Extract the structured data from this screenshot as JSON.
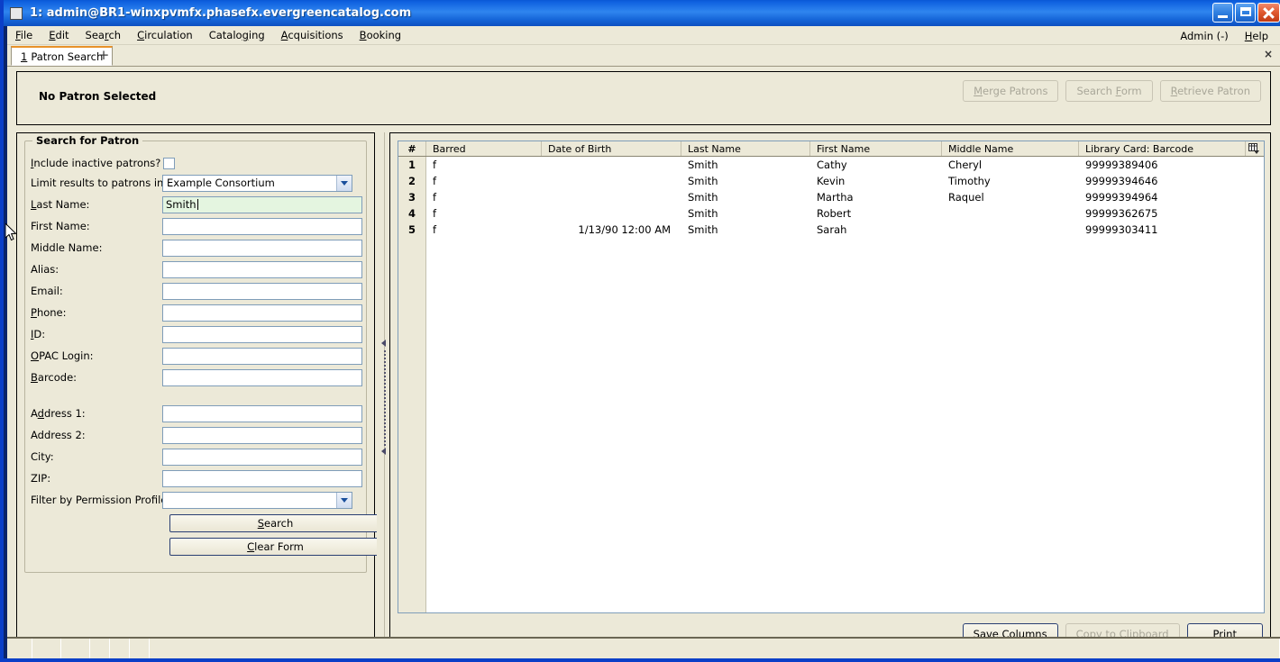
{
  "window": {
    "title": "1: admin@BR1-winxpvmfx.phasefx.evergreencatalog.com",
    "icon": "window-icon",
    "minimize": "minimize-icon",
    "maximize": "maximize-icon",
    "close": "close-icon"
  },
  "menubar": {
    "items": [
      {
        "label": "File",
        "accel": "F"
      },
      {
        "label": "Edit",
        "accel": "E"
      },
      {
        "label": "Search",
        "accel": "r"
      },
      {
        "label": "Circulation",
        "accel": "C"
      },
      {
        "label": "Cataloging",
        "accel": "g"
      },
      {
        "label": "Acquisitions",
        "accel": "A"
      },
      {
        "label": "Booking",
        "accel": "B"
      }
    ],
    "right": [
      {
        "label": "Admin (-)"
      },
      {
        "label": "Help",
        "accel": "H"
      }
    ]
  },
  "tabbar": {
    "tabs": [
      {
        "index": "1",
        "label": "Patron Search",
        "active": true
      }
    ],
    "add_label": "+",
    "close_label": "×"
  },
  "patron_header": {
    "status": "No Patron Selected",
    "buttons": [
      {
        "label": "Merge Patrons",
        "enabled": false
      },
      {
        "label": "Search Form",
        "enabled": false
      },
      {
        "label": "Retrieve Patron",
        "enabled": false
      }
    ]
  },
  "search_form": {
    "legend": "Search for Patron",
    "include_inactive": {
      "label": "Include inactive patrons?",
      "checked": false
    },
    "limit_results": {
      "label": "Limit results to patrons in",
      "value": "Example Consortium"
    },
    "fields": [
      {
        "label": "Last Name:",
        "value": "Smith",
        "focused": true
      },
      {
        "label": "First Name:",
        "value": "",
        "focused": false
      },
      {
        "label": "Middle Name:",
        "value": "",
        "focused": false
      },
      {
        "label": "Alias:",
        "value": "",
        "focused": false
      },
      {
        "label": "Email:",
        "value": "",
        "focused": false
      },
      {
        "label": "Phone:",
        "value": "",
        "focused": false
      },
      {
        "label": "ID:",
        "value": "",
        "focused": false
      },
      {
        "label": "OPAC Login:",
        "value": "",
        "focused": false
      },
      {
        "label": "Barcode:",
        "value": "",
        "focused": false
      }
    ],
    "address_fields": [
      {
        "label": "Address 1:",
        "value": ""
      },
      {
        "label": "Address 2:",
        "value": ""
      },
      {
        "label": "City:",
        "value": ""
      },
      {
        "label": "ZIP:",
        "value": ""
      }
    ],
    "permission_profile": {
      "label": "Filter by Permission Profile:",
      "value": ""
    },
    "search_button": "Search",
    "clear_button": "Clear Form"
  },
  "results": {
    "columns": [
      "#",
      "Barred",
      "Date of Birth",
      "Last Name",
      "First Name",
      "Middle Name",
      "Library Card: Barcode"
    ],
    "column_picker_icon": "column-picker-icon",
    "rows": [
      {
        "num": "1",
        "barred": "f",
        "dob": "",
        "last": "Smith",
        "first": "Cathy",
        "middle": "Cheryl",
        "barcode": "99999389406"
      },
      {
        "num": "2",
        "barred": "f",
        "dob": "",
        "last": "Smith",
        "first": "Kevin",
        "middle": "Timothy",
        "barcode": "99999394646"
      },
      {
        "num": "3",
        "barred": "f",
        "dob": "",
        "last": "Smith",
        "first": "Martha",
        "middle": "Raquel",
        "barcode": "99999394964"
      },
      {
        "num": "4",
        "barred": "f",
        "dob": "",
        "last": "Smith",
        "first": "Robert",
        "middle": "",
        "barcode": "99999362675"
      },
      {
        "num": "5",
        "barred": "f",
        "dob": "1/13/90 12:00 AM",
        "last": "Smith",
        "first": "Sarah",
        "middle": "",
        "barcode": "99999303411"
      }
    ],
    "actions": [
      {
        "label": "Save Columns",
        "enabled": true
      },
      {
        "label": "Copy to Clipboard",
        "enabled": false
      },
      {
        "label": "Print",
        "enabled": true
      }
    ]
  },
  "colors": {
    "titlebar_blue": "#1062e0",
    "frame_blue": "#0b3fc8",
    "chrome_beige": "#ece9d8",
    "focused_field_green": "#e4f5e0",
    "tab_accent_orange": "#e8922a",
    "field_border": "#7f9db9",
    "default_button_border": "#2a3f73"
  }
}
